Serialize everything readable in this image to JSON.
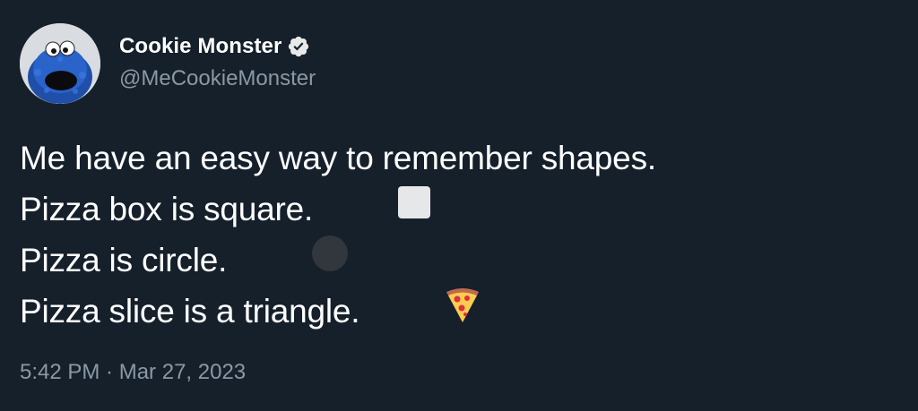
{
  "author": {
    "display_name": "Cookie Monster",
    "handle": "@MeCookieMonster",
    "verified": true,
    "avatar_icon": "cookie-monster-avatar"
  },
  "tweet": {
    "lines": [
      {
        "text": "Me have an easy way to remember shapes.",
        "emoji": ""
      },
      {
        "text": "Pizza box is square.",
        "emoji": "white-square-emoji"
      },
      {
        "text": "Pizza is circle.",
        "emoji": "black-circle-emoji"
      },
      {
        "text": "Pizza slice is a triangle.",
        "emoji": "pizza-emoji"
      }
    ]
  },
  "meta": {
    "time": "5:42 PM",
    "separator": " · ",
    "date": "Mar 27, 2023"
  },
  "colors": {
    "background": "#15202b",
    "text": "#ffffff",
    "secondary_text": "#8b98a5",
    "verified_badge": "#e7e9ea"
  }
}
